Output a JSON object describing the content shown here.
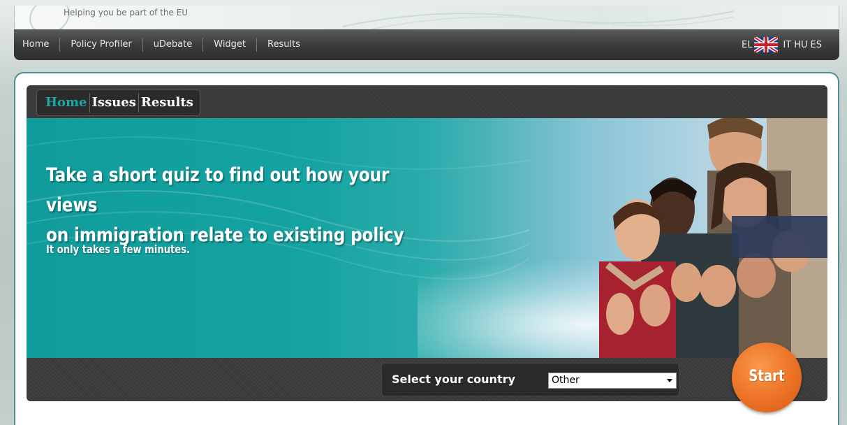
{
  "header": {
    "tagline": "Helping you be part of the EU"
  },
  "nav": {
    "items": [
      "Home",
      "Policy Profiler",
      "uDebate",
      "Widget",
      "Results"
    ],
    "languages": [
      "EL",
      "IT",
      "HU",
      "ES"
    ]
  },
  "widget": {
    "tabs": [
      {
        "label": "Home",
        "active": true
      },
      {
        "label": "Issues",
        "active": false
      },
      {
        "label": "Results",
        "active": false
      }
    ],
    "hero": {
      "title_line1": "Take a short quiz to find out how your views",
      "title_line2": "on immigration relate to existing policy",
      "subtitle": "It only takes a few minutes."
    },
    "country": {
      "label": "Select your country",
      "selected": "Other"
    },
    "start_label": "Start"
  },
  "colors": {
    "accent_teal": "#1aa9a6",
    "start_orange": "#ee7428",
    "nav_dark": "#3b3d3c"
  }
}
